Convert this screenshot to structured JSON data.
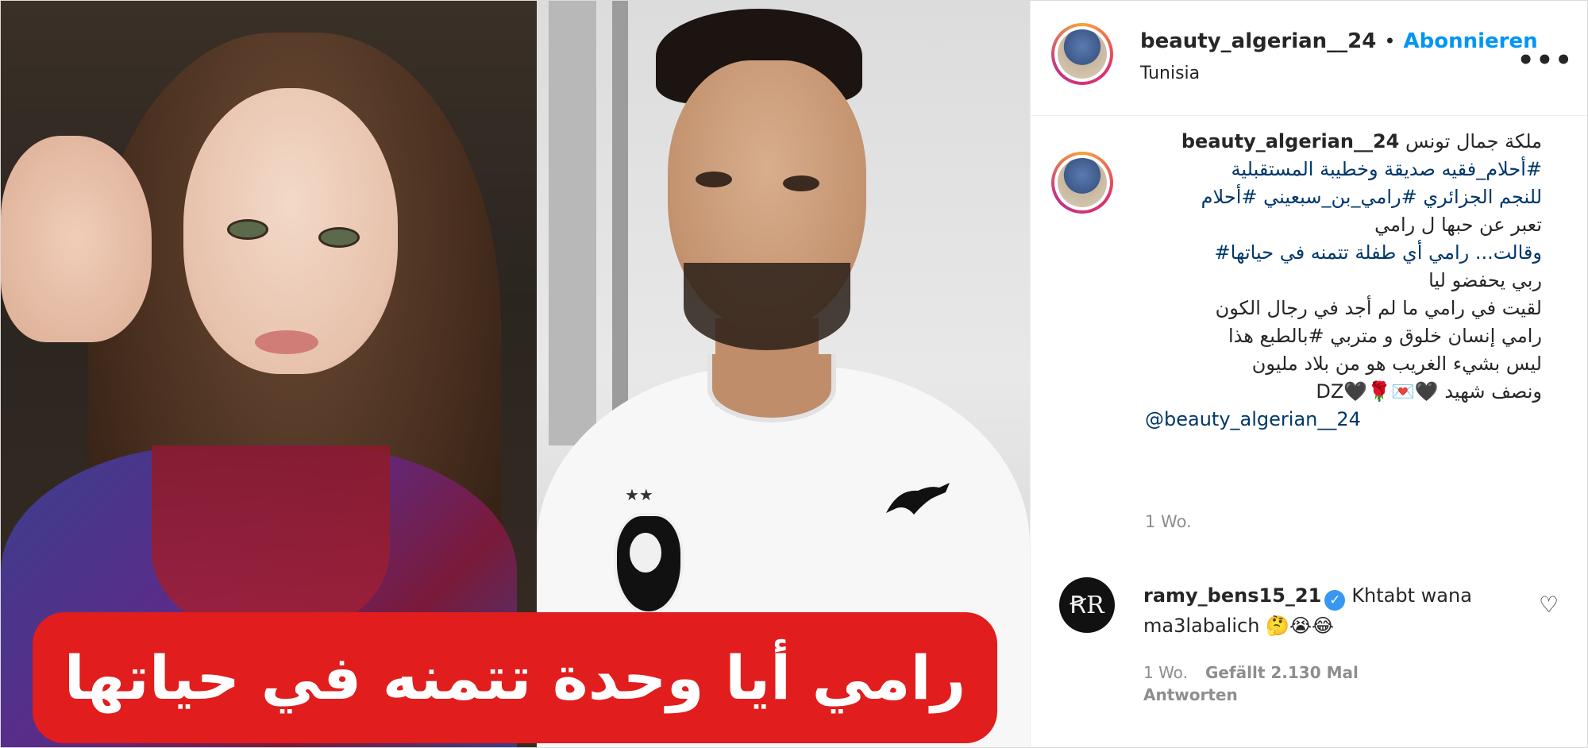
{
  "post": {
    "author": "beauty_algerian__24",
    "follow_label": "Abonnieren",
    "separator": "•",
    "location": "Tunisia",
    "more_label": "•••",
    "image_caption_text": "رامي أيا وحدة تتمنه في حياتها"
  },
  "caption": {
    "username": "beauty_algerian__24",
    "lines": [
      "ملكة جمال تونس",
      "#أحلام_فقيه صديقة وخطيبة المستقبلية",
      "للنجم الجزائري #رامي_بن_سبعيني #أحلام",
      "تعبر عن حبها ل رامي",
      "وقالت... رامي أي طفلة تتمنه في حياتها#",
      "ربي يحفضو ليا",
      "لقيت في رامي ما لم أجد في رجال الكون",
      "رامي إنسان خلوق و متربي #بالطبع هذا",
      "ليس بشيء الغريب هو من بلاد مليون",
      "ونصف شهيد 🖤💌🌹🖤DZ"
    ],
    "mention": "@beauty_algerian__24",
    "time": "1 Wo."
  },
  "comment": {
    "avatar_text": "ꞦR",
    "username": "ramy_bens15_21",
    "verified_mark": "✓",
    "text": "Khtabt wana ma3labalich",
    "emojis": "🤔😭😂",
    "time": "1 Wo.",
    "likes": "Gefällt 2.130 Mal",
    "reply_label": "Antworten",
    "heart_icon": "♡"
  },
  "colors": {
    "accent": "#0095f6",
    "hashtag": "#00376b",
    "banner": "#e11d1d",
    "meta": "#8e8e8e"
  }
}
